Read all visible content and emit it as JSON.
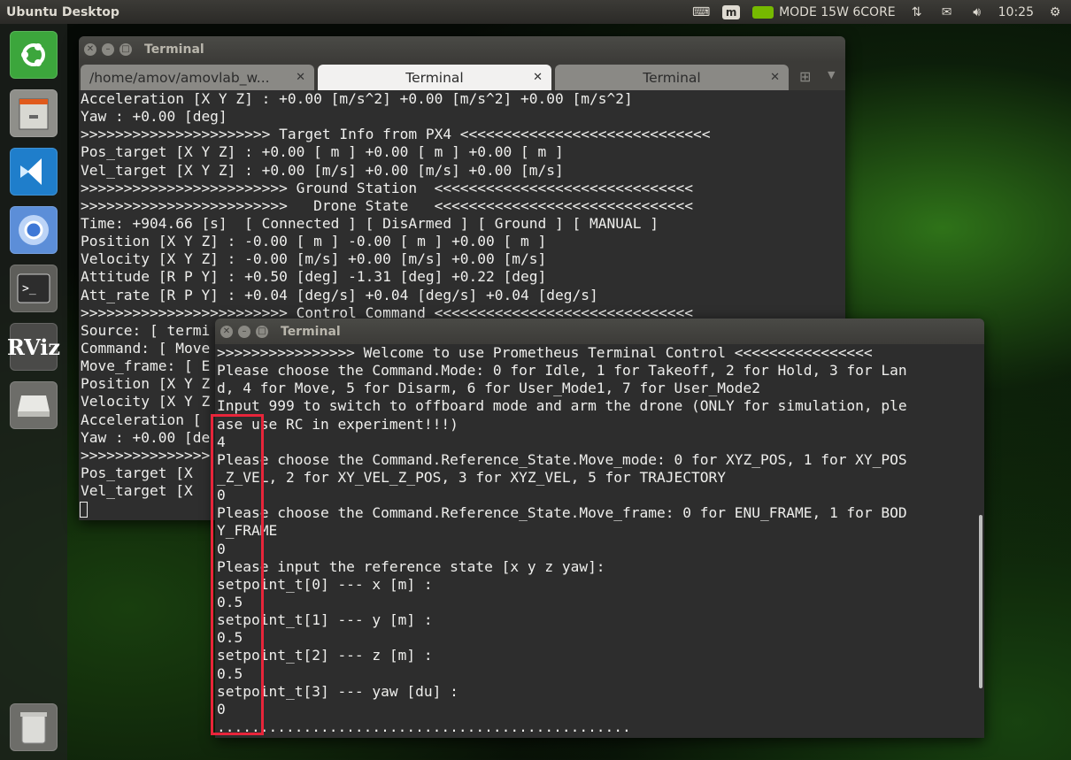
{
  "top_panel": {
    "title": "Ubuntu Desktop",
    "mode_text": "MODE 15W 6CORE",
    "clock": "10:25"
  },
  "launcher": {
    "items": [
      "ubuntu-home",
      "files",
      "vscode",
      "chromium",
      "terminal",
      "rviz",
      "drive",
      "trash"
    ]
  },
  "back_terminal": {
    "window_title": "Terminal",
    "tabs": [
      {
        "label": "/home/amov/amovlab_w...",
        "active": false
      },
      {
        "label": "Terminal",
        "active": true
      },
      {
        "label": "Terminal",
        "active": false
      }
    ],
    "lines": [
      "Acceleration [X Y Z] : +0.00 [m/s^2] +0.00 [m/s^2] +0.00 [m/s^2]",
      "Yaw : +0.00 [deg]",
      ">>>>>>>>>>>>>>>>>>>>>> Target Info from PX4 <<<<<<<<<<<<<<<<<<<<<<<<<<<<<",
      "Pos_target [X Y Z] : +0.00 [ m ] +0.00 [ m ] +0.00 [ m ]",
      "Vel_target [X Y Z] : +0.00 [m/s] +0.00 [m/s] +0.00 [m/s]",
      ">>>>>>>>>>>>>>>>>>>>>>>> Ground Station  <<<<<<<<<<<<<<<<<<<<<<<<<<<<<<",
      ">>>>>>>>>>>>>>>>>>>>>>>>   Drone State   <<<<<<<<<<<<<<<<<<<<<<<<<<<<<<",
      "Time: +904.66 [s]  [ Connected ] [ DisArmed ] [ Ground ] [ MANUAL ]",
      "Position [X Y Z] : -0.00 [ m ] -0.00 [ m ] +0.00 [ m ]",
      "Velocity [X Y Z] : -0.00 [m/s] +0.00 [m/s] +0.00 [m/s]",
      "Attitude [R P Y] : +0.50 [deg] -1.31 [deg] +0.22 [deg]",
      "Att_rate [R P Y] : +0.04 [deg/s] +0.04 [deg/s] +0.04 [deg/s]",
      ">>>>>>>>>>>>>>>>>>>>>>>> Control Command <<<<<<<<<<<<<<<<<<<<<<<<<<<<<<",
      "Source: [ termi",
      "Command: [ Move",
      "Move_frame: [ E",
      "Position [X Y Z",
      "Velocity [X Y Z",
      "Acceleration [",
      "Yaw : +0.00 [de",
      ">>>>>>>>>>>>>>>",
      "Pos_target [X ",
      "Vel_target [X "
    ]
  },
  "front_terminal": {
    "window_title": "Terminal",
    "lines": [
      ">>>>>>>>>>>>>>>> Welcome to use Prometheus Terminal Control <<<<<<<<<<<<<<<<",
      "Please choose the Command.Mode: 0 for Idle, 1 for Takeoff, 2 for Hold, 3 for Lan",
      "d, 4 for Move, 5 for Disarm, 6 for User_Mode1, 7 for User_Mode2",
      "Input 999 to switch to offboard mode and arm the drone (ONLY for simulation, ple",
      "ase use RC in experiment!!!)",
      "4",
      "Please choose the Command.Reference_State.Move_mode: 0 for XYZ_POS, 1 for XY_POS",
      "_Z_VEL, 2 for XY_VEL_Z_POS, 3 for XYZ_VEL, 5 for TRAJECTORY",
      "0",
      "Please choose the Command.Reference_State.Move_frame: 0 for ENU_FRAME, 1 for BOD",
      "Y_FRAME",
      "0",
      "Please input the reference state [x y z yaw]:",
      "setpoint_t[0] --- x [m] :",
      "0.5",
      "setpoint_t[1] --- y [m] :",
      "0.5",
      "setpoint_t[2] --- z [m] :",
      "0.5",
      "setpoint_t[3] --- yaw [du] :",
      "0",
      "................................................"
    ]
  },
  "colors": {
    "highlight": "#e8253a",
    "terminal_bg": "#2e2e2e",
    "terminal_fg": "#eeeeec"
  }
}
